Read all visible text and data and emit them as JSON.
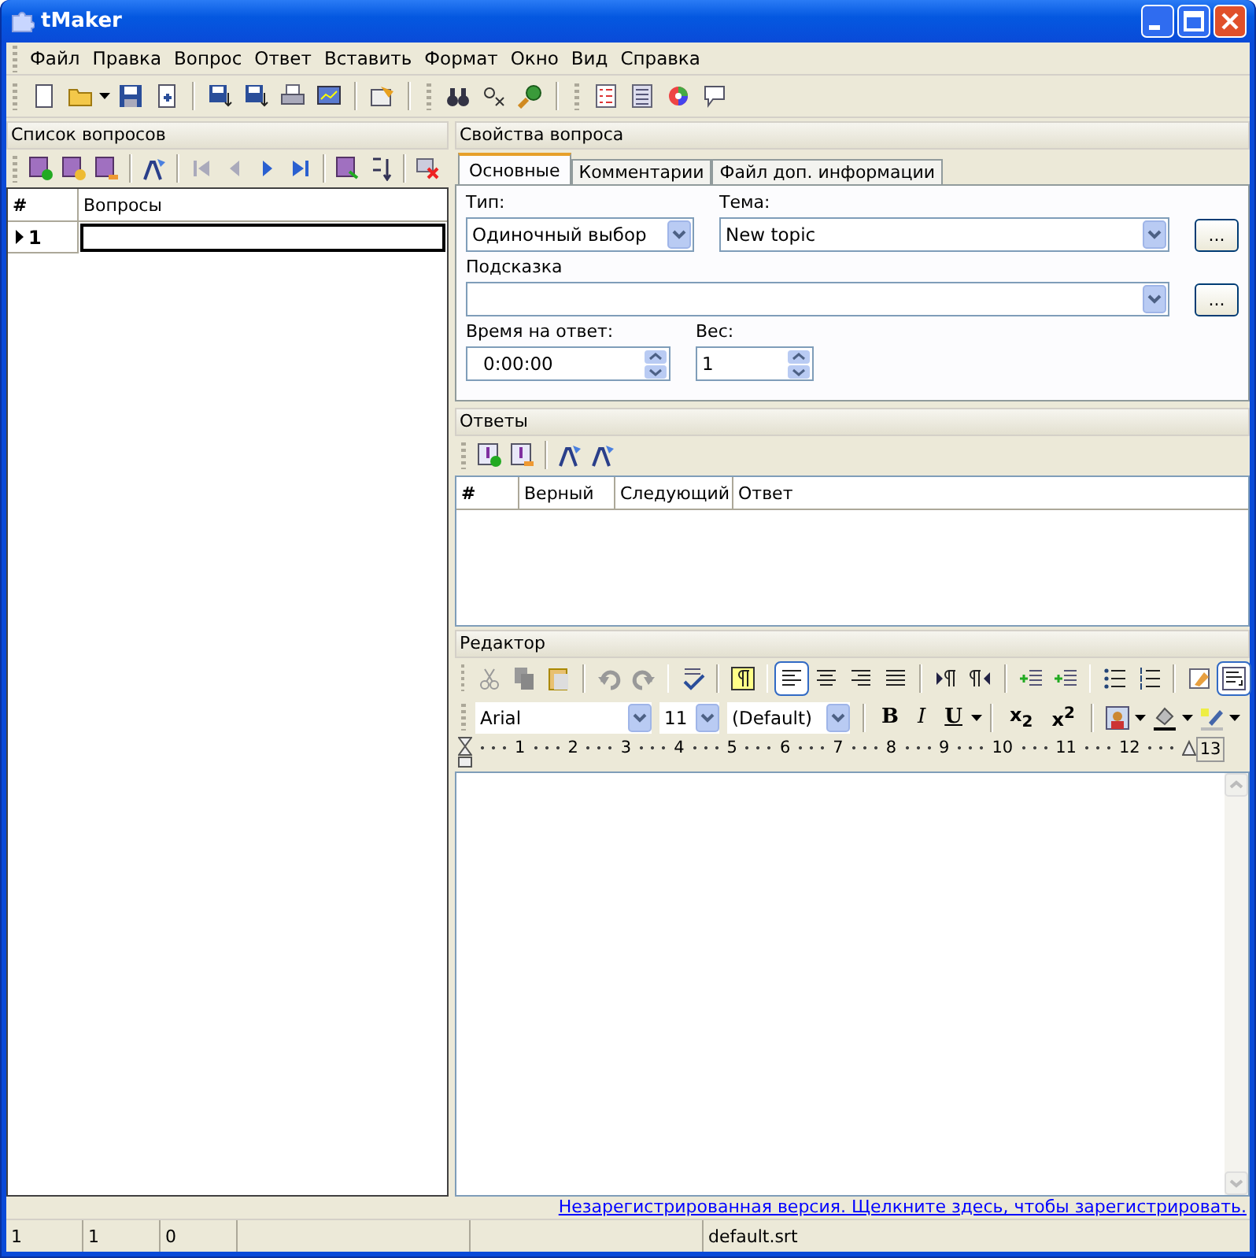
{
  "window": {
    "title": "tMaker"
  },
  "menu": [
    "Файл",
    "Правка",
    "Вопрос",
    "Ответ",
    "Вставить",
    "Формат",
    "Окно",
    "Вид",
    "Справка"
  ],
  "questions_panel": {
    "title": "Список вопросов",
    "columns": [
      "#",
      "Вопросы"
    ],
    "rows": [
      {
        "number": "1",
        "current": true,
        "text": ""
      }
    ]
  },
  "properties_panel": {
    "title": "Свойства вопроса",
    "tabs": [
      {
        "label": "Основные",
        "selected": true
      },
      {
        "label": "Комментарии",
        "selected": false
      },
      {
        "label": "Файл доп. информации",
        "selected": false
      }
    ],
    "type": {
      "label": "Тип:",
      "value": "Одиночный выбор"
    },
    "topic": {
      "label": "Тема:",
      "value": "New topic",
      "button": "..."
    },
    "hint": {
      "label": "Подсказка",
      "button": "..."
    },
    "time": {
      "label": "Время на ответ:",
      "value": "0:00:00"
    },
    "weight": {
      "label": "Вес:",
      "value": "1"
    }
  },
  "answers_panel": {
    "title": "Ответы",
    "columns": [
      "#",
      "Верный",
      "Следующий",
      "Ответ"
    ]
  },
  "editor_panel": {
    "title": "Редактор",
    "font": "Arial",
    "size": "11",
    "style": "(Default)",
    "format_buttons": [
      {
        "label": "B",
        "kind": "bold"
      },
      {
        "label": "I",
        "kind": "italic"
      },
      {
        "label": "U",
        "kind": "underline"
      }
    ],
    "script_buttons": [
      "x$_{2}$",
      "x$^{2}$"
    ],
    "ruler": [
      "1",
      "2",
      "3",
      "4",
      "5",
      "6",
      "7",
      "8",
      "9",
      "10",
      "11",
      "12",
      "13"
    ]
  },
  "register_link": "Незарегистрированная версия. Щелкните здесь, чтобы зарегистрировать.",
  "status_bar": {
    "cells": [
      "1",
      "1",
      "0"
    ],
    "file": "default.srt"
  }
}
